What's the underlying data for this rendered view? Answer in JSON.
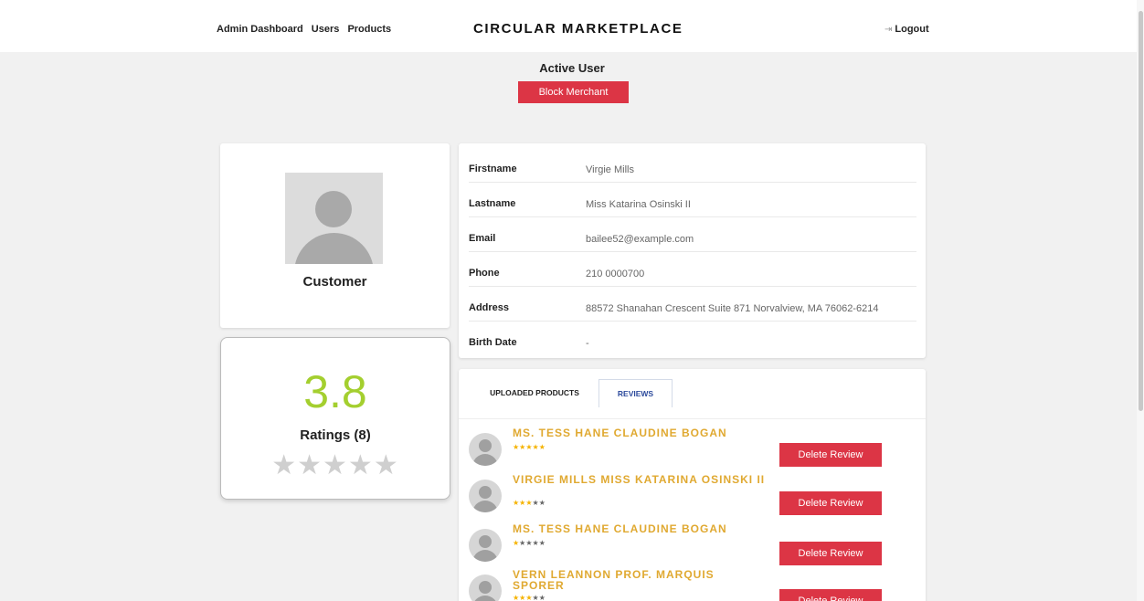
{
  "nav": {
    "links": [
      "Admin Dashboard",
      "Users",
      "Products"
    ],
    "brand": "CIRCULAR MARKETPLACE",
    "logout_label": "Logout",
    "logout_icon": "logout-icon"
  },
  "status": {
    "title": "Active User",
    "block_label": "Block Merchant"
  },
  "profile": {
    "role": "Customer",
    "avatar_icon": "user-avatar-icon"
  },
  "rating": {
    "value": "3.8",
    "count_label": "Ratings (8)",
    "stars": "★★★★★"
  },
  "info": [
    {
      "label": "Firstname",
      "value": "Virgie Mills"
    },
    {
      "label": "Lastname",
      "value": "Miss Katarina Osinski II"
    },
    {
      "label": "Email",
      "value": "bailee52@example.com"
    },
    {
      "label": "Phone",
      "value": "210 0000700"
    },
    {
      "label": "Address",
      "value": "88572 Shanahan Crescent Suite 871 Norvalview, MA 76062-6214"
    },
    {
      "label": "Birth Date",
      "value": "-"
    }
  ],
  "tabs": {
    "products": "UPLOADED PRODUCTS",
    "reviews": "REVIEWS",
    "active": "reviews"
  },
  "reviews": [
    {
      "name": "MS. TESS HANE CLAUDINE BOGAN",
      "rating": 5,
      "button": "Delete Review"
    },
    {
      "name": "VIRGIE MILLS MISS KATARINA OSINSKI II",
      "rating": 3,
      "button": "Delete Review"
    },
    {
      "name": "MS. TESS HANE CLAUDINE BOGAN",
      "rating": 1,
      "button": "Delete Review"
    },
    {
      "name": "VERN LEANNON PROF. MARQUIS SPORER",
      "rating": 3,
      "button": "Delete Review"
    }
  ],
  "colors": {
    "danger": "#dc3545",
    "rating_green": "#a4cf2f",
    "reviewer_gold": "#e0a931",
    "star_on": "#f5b301",
    "tab_active": "#2c4a9c"
  }
}
